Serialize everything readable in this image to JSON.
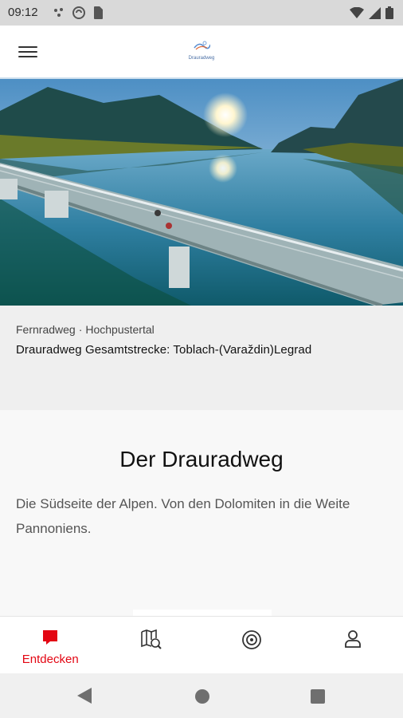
{
  "status_bar": {
    "time": "09:12",
    "icons_left": [
      "cast-icon",
      "no-disturb-icon",
      "sim-card-icon"
    ],
    "icons_right": [
      "wifi-icon",
      "signal-icon",
      "battery-icon"
    ]
  },
  "app_bar": {
    "logo_text": "Drauradweg"
  },
  "hero": {
    "image": "bridge-over-lake-photo"
  },
  "tour": {
    "category": "Fernradweg",
    "separator": "·",
    "region": "Hochpustertal",
    "title": "Drauradweg Gesamtstrecke: Toblach-(Varaždin)Legrad"
  },
  "intro": {
    "heading": "Der Drauradweg",
    "text": "Die Südseite der Alpen. Von den Dolomiten in die Weite Pannoniens."
  },
  "bottom_nav": {
    "items": [
      {
        "label": "Entdecken",
        "icon": "discover-icon",
        "active": true
      },
      {
        "label": "",
        "icon": "map-search-icon",
        "active": false
      },
      {
        "label": "",
        "icon": "target-icon",
        "active": false
      },
      {
        "label": "",
        "icon": "profile-icon",
        "active": false
      }
    ]
  },
  "colors": {
    "accent": "#e30613",
    "status_bar": "#d9d9d9",
    "info_bg": "#efefef"
  }
}
